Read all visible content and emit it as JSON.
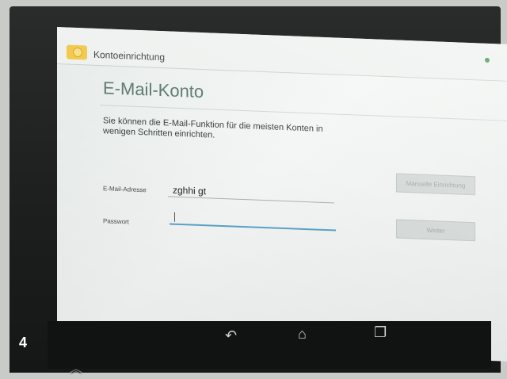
{
  "app": {
    "title": "Kontoeinrichtung"
  },
  "page": {
    "heading": "E-Mail-Konto",
    "intro": "Sie können die E-Mail-Funktion für die meisten Konten in wenigen Schritten einrichten."
  },
  "form": {
    "email_label": "E-Mail-Adresse",
    "email_value": "zghhi gt",
    "password_label": "Passwort",
    "password_value": ""
  },
  "buttons": {
    "manual_setup": "Manuelle Einrichtung",
    "next": "Weiter"
  },
  "navbar": {
    "back_icon": "back-arrow-icon",
    "home_icon": "home-icon",
    "recents_icon": "recent-apps-icon"
  },
  "photo": {
    "step_number": "4"
  }
}
